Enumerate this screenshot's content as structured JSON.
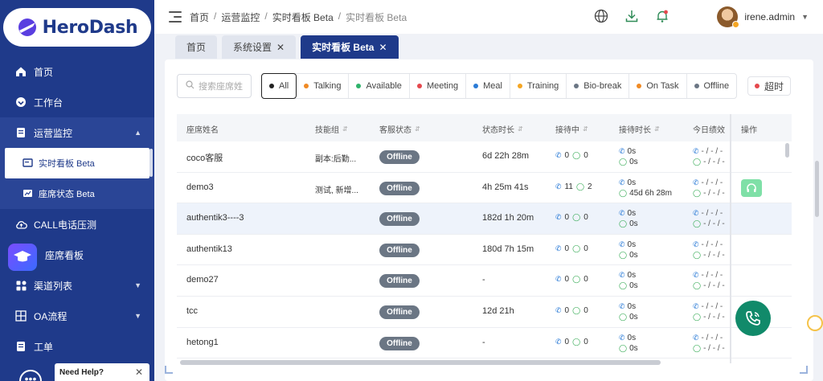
{
  "app": {
    "logo_text": "HeroDash"
  },
  "sidebar": {
    "items": [
      {
        "label": "首页",
        "icon": "home-icon"
      },
      {
        "label": "工作台",
        "icon": "dashboard-icon"
      },
      {
        "label": "运营监控",
        "icon": "monitor-icon",
        "expanded": true,
        "children": [
          {
            "label": "实时看板 Beta",
            "icon": "board-icon",
            "active": true
          },
          {
            "label": "座席状态 Beta",
            "icon": "chart-icon"
          }
        ]
      },
      {
        "label": "CALL电话压测",
        "icon": "cloud-upload-icon"
      },
      {
        "label": "座席看板",
        "icon": "graduation-icon"
      },
      {
        "label": "渠道列表",
        "icon": "grid-icon",
        "has_children": true
      },
      {
        "label": "OA流程",
        "icon": "flow-icon",
        "has_children": true
      },
      {
        "label": "工单",
        "icon": "ticket-icon"
      }
    ],
    "help": {
      "label": "Need Help?"
    }
  },
  "header": {
    "breadcrumb": [
      "首页",
      "运营监控",
      "实时看板 Beta",
      "实时看板 Beta"
    ],
    "user": {
      "name": "irene.admin"
    }
  },
  "tabs": [
    {
      "label": "首页",
      "closable": false
    },
    {
      "label": "系统设置",
      "closable": true
    },
    {
      "label": "实时看板 Beta",
      "closable": true,
      "active": true
    }
  ],
  "toolbar": {
    "search_placeholder": "搜索座席姓",
    "filters": [
      {
        "label": "All",
        "color": "#222222",
        "active": true
      },
      {
        "label": "Talking",
        "color": "#f08a24"
      },
      {
        "label": "Available",
        "color": "#2fb36b"
      },
      {
        "label": "Meeting",
        "color": "#e5484d"
      },
      {
        "label": "Meal",
        "color": "#2b7bd6"
      },
      {
        "label": "Training",
        "color": "#f5a623"
      },
      {
        "label": "Bio-break",
        "color": "#6b7684"
      },
      {
        "label": "On Task",
        "color": "#f08a24"
      },
      {
        "label": "Offline",
        "color": "#6b7684"
      }
    ],
    "timeout": {
      "label": "超时",
      "color": "#e5484d"
    }
  },
  "table": {
    "columns": [
      "座席姓名",
      "技能组",
      "客服状态",
      "状态时长",
      "接待中",
      "接待时长",
      "今日绩效",
      "操作"
    ],
    "rows": [
      {
        "name": "coco客服",
        "group": "副本:后勤...",
        "status": "Offline",
        "duration": "6d 22h 28m",
        "calls": "0",
        "chats": "0",
        "call_time": "0s",
        "chat_time": "0s",
        "perf1": "- / - / -",
        "perf2": "- / - / -"
      },
      {
        "name": "demo3",
        "group": "测试, 新增...",
        "status": "Offline",
        "duration": "4h 25m 41s",
        "calls": "11",
        "chats": "2",
        "call_time": "0s",
        "chat_time": "45d 6h 28m",
        "perf1": "- / - / -",
        "perf2": "- / - / -",
        "has_action": true
      },
      {
        "name": "authentik3----3",
        "group": "",
        "status": "Offline",
        "duration": "182d 1h 20m",
        "calls": "0",
        "chats": "0",
        "call_time": "0s",
        "chat_time": "0s",
        "perf1": "- / - / -",
        "perf2": "- / - / -"
      },
      {
        "name": "authentik13",
        "group": "",
        "status": "Offline",
        "duration": "180d 7h 15m",
        "calls": "0",
        "chats": "0",
        "call_time": "0s",
        "chat_time": "0s",
        "perf1": "- / - / -",
        "perf2": "- / - / -"
      },
      {
        "name": "demo27",
        "group": "",
        "status": "Offline",
        "duration": "-",
        "calls": "0",
        "chats": "0",
        "call_time": "0s",
        "chat_time": "0s",
        "perf1": "- / - / -",
        "perf2": "- / - / -"
      },
      {
        "name": "tcc",
        "group": "",
        "status": "Offline",
        "duration": "12d 21h",
        "calls": "0",
        "chats": "0",
        "call_time": "0s",
        "chat_time": "0s",
        "perf1": "- / - / -",
        "perf2": "- / - / -"
      },
      {
        "name": "hetong1",
        "group": "",
        "status": "Offline",
        "duration": "-",
        "calls": "0",
        "chats": "0",
        "call_time": "0s",
        "chat_time": "0s",
        "perf1": "- / - / -",
        "perf2": "- / - / -"
      }
    ]
  }
}
